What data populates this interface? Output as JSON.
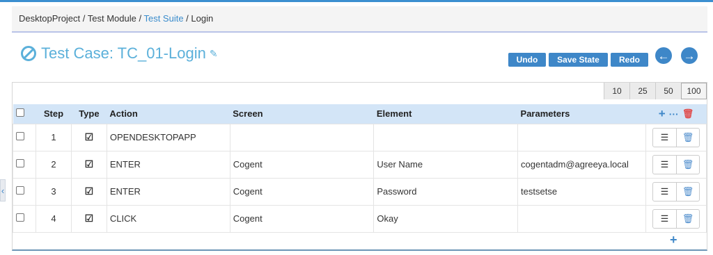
{
  "breadcrumb": {
    "part1": "DesktopProject",
    "sep": " / ",
    "part2": "Test Module",
    "part3": "Test Suite",
    "part4": "Login"
  },
  "title": {
    "text": "Test Case: TC_01-Login"
  },
  "toolbar": {
    "undo": "Undo",
    "save_state": "Save State",
    "redo": "Redo"
  },
  "pager": [
    "10",
    "25",
    "50",
    "100"
  ],
  "pager_active": "100",
  "table": {
    "headers": [
      "Step",
      "Type",
      "Action",
      "Screen",
      "Element",
      "Parameters"
    ],
    "rows": [
      {
        "step": "1",
        "action": "OPENDESKTOPAPP",
        "screen": "",
        "element": "",
        "parameters": ""
      },
      {
        "step": "2",
        "action": "ENTER",
        "screen": "Cogent",
        "element": "User Name",
        "parameters": "cogentadm@agreeya.local"
      },
      {
        "step": "3",
        "action": "ENTER",
        "screen": "Cogent",
        "element": "Password",
        "parameters": "testsetse"
      },
      {
        "step": "4",
        "action": "CLICK",
        "screen": "Cogent",
        "element": "Okay",
        "parameters": ""
      }
    ]
  },
  "icons": {
    "title": "ban-icon",
    "edit": "edit-icon",
    "prev": "arrow-left-circle-icon",
    "next": "arrow-right-circle-icon",
    "type": "check-square-icon",
    "settings": "sliders-icon",
    "delete": "trash-icon",
    "add": "plus-icon",
    "more": "ellipsis-icon"
  },
  "colors": {
    "accent": "#3e87c8",
    "title": "#5bb0da",
    "header": "#d3e5f7",
    "danger": "#e05151"
  }
}
